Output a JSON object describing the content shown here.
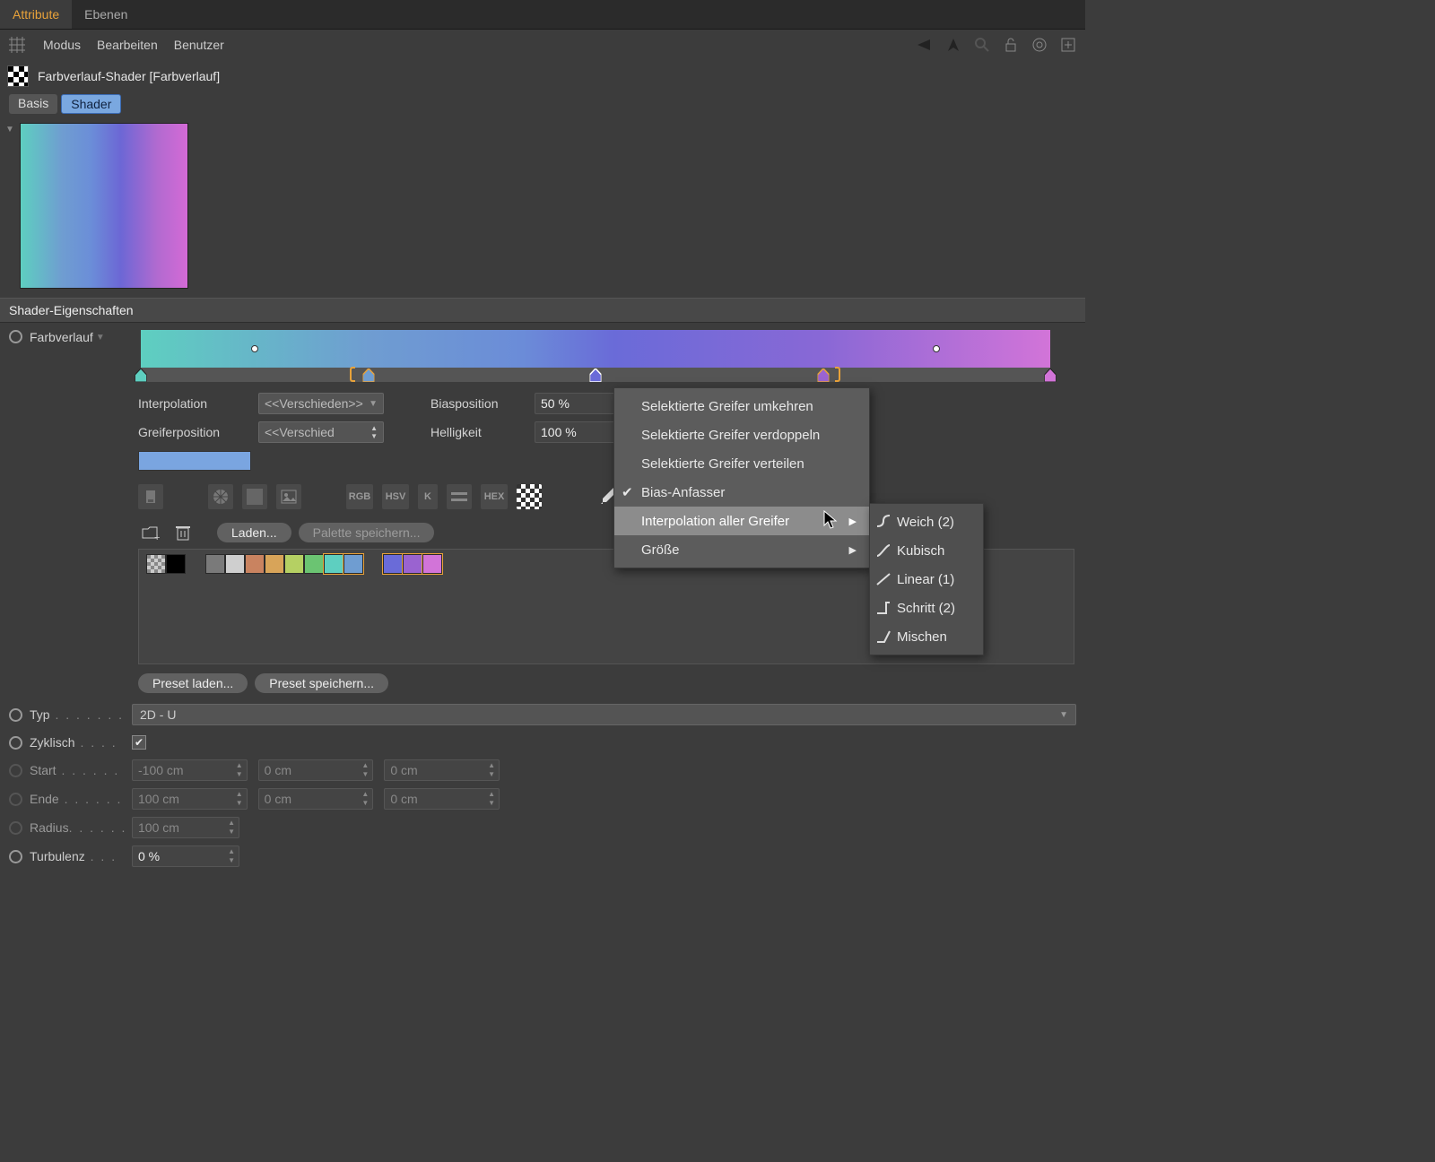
{
  "tabs": {
    "attribute": "Attribute",
    "ebenen": "Ebenen"
  },
  "menu": {
    "modus": "Modus",
    "bearbeiten": "Bearbeiten",
    "benutzer": "Benutzer"
  },
  "header": {
    "title": "Farbverlauf-Shader [Farbverlauf]"
  },
  "subtabs": {
    "basis": "Basis",
    "shader": "Shader"
  },
  "section": {
    "title": "Shader-Eigenschaften"
  },
  "gradient": {
    "label": "Farbverlauf",
    "interpolation_label": "Interpolation",
    "interpolation_value": "<<Verschieden>>",
    "greifer_label": "Greiferposition",
    "greifer_value": "<<Verschied",
    "bias_label": "Biasposition",
    "bias_value": "50 %",
    "hell_label": "Helligkeit",
    "hell_value": "100 %"
  },
  "icons": {
    "rgb": "RGB",
    "hsv": "HSV",
    "k": "K",
    "hex": "HEX"
  },
  "palette": {
    "laden": "Laden...",
    "speichern": "Palette speichern..."
  },
  "presets": {
    "laden": "Preset laden...",
    "speichern": "Preset speichern..."
  },
  "props": {
    "typ_label": "Typ",
    "typ_value": "2D - U",
    "zyklisch_label": "Zyklisch",
    "start_label": "Start",
    "start_x": "-100 cm",
    "start_y": "0 cm",
    "start_z": "0 cm",
    "ende_label": "Ende",
    "ende_x": "100 cm",
    "ende_y": "0 cm",
    "ende_z": "0 cm",
    "radius_label": "Radius",
    "radius_value": "100 cm",
    "turbulenz_label": "Turbulenz",
    "turbulenz_value": "0 %"
  },
  "context": {
    "umkehren": "Selektierte Greifer umkehren",
    "verdoppeln": "Selektierte Greifer verdoppeln",
    "verteilen": "Selektierte Greifer verteilen",
    "bias": "Bias-Anfasser",
    "interp": "Interpolation aller Greifer",
    "groesse": "Größe"
  },
  "submenu": {
    "weich": "Weich (2)",
    "kubisch": "Kubisch",
    "linear": "Linear (1)",
    "schritt": "Schritt (2)",
    "mischen": "Mischen"
  }
}
